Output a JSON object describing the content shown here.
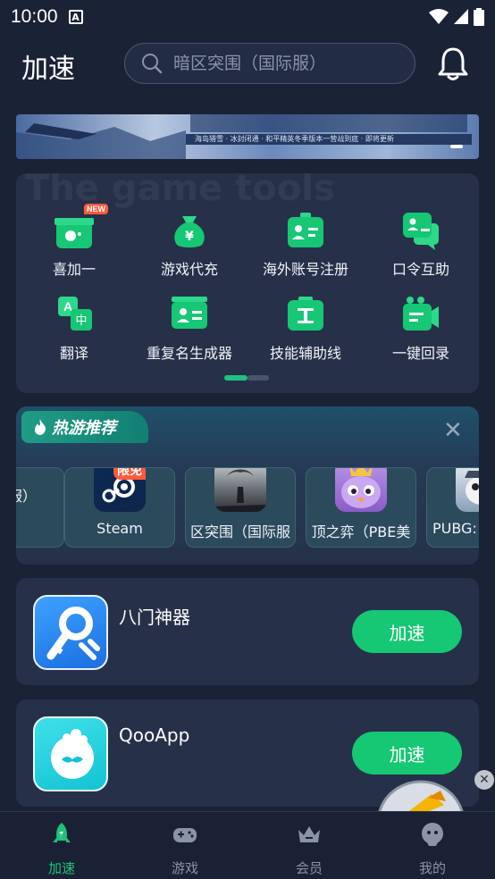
{
  "status_bar": {
    "time": "10:00",
    "notification_icon": "A"
  },
  "header": {
    "title": "加速"
  },
  "search": {
    "placeholder": "暗区突围（国际服）"
  },
  "banner": {
    "strip_text": "海岛猎雪 · 冰封闭通 · 和平精英冬季版本一营战到底 · 即将更新"
  },
  "tools": {
    "watermark": "The game tools",
    "items": [
      {
        "label": "喜加一",
        "icon": "gamepad-gift-icon",
        "badge": "NEW"
      },
      {
        "label": "游戏代充",
        "icon": "money-bag-icon"
      },
      {
        "label": "海外账号注册",
        "icon": "id-card-icon"
      },
      {
        "label": "口令互助",
        "icon": "chat-users-icon"
      },
      {
        "label": "翻译",
        "icon": "translate-icon"
      },
      {
        "label": "重复名生成器",
        "icon": "name-card-icon"
      },
      {
        "label": "技能辅助线",
        "icon": "skill-line-icon"
      },
      {
        "label": "一键回录",
        "icon": "video-record-icon"
      }
    ]
  },
  "hot_games": {
    "title": "热游推荐",
    "games": [
      {
        "name": "服）",
        "icon": "game-icon"
      },
      {
        "name": "Steam",
        "icon": "steam-icon",
        "badge": "限免"
      },
      {
        "name": "区突围（国际服",
        "icon": "game-icon"
      },
      {
        "name": "顶之弈（PBE美",
        "icon": "game-icon"
      },
      {
        "name": "PUBG:",
        "icon": "game-icon"
      }
    ]
  },
  "apps": [
    {
      "name": "八门神器",
      "button": "加速",
      "icon": "key-wrench-icon"
    },
    {
      "name": "QooApp",
      "button": "加速",
      "icon": "qooapp-icon"
    }
  ],
  "tabbar": {
    "tabs": [
      {
        "label": "加速",
        "icon": "rocket-icon",
        "active": true
      },
      {
        "label": "游戏",
        "icon": "gamepad-icon"
      },
      {
        "label": "会员",
        "icon": "crown-icon"
      },
      {
        "label": "我的",
        "icon": "profile-icon"
      }
    ]
  },
  "colors": {
    "background": "#1a2236",
    "card": "#263149",
    "accent": "#16c774",
    "badge": "#ff5a3c"
  }
}
